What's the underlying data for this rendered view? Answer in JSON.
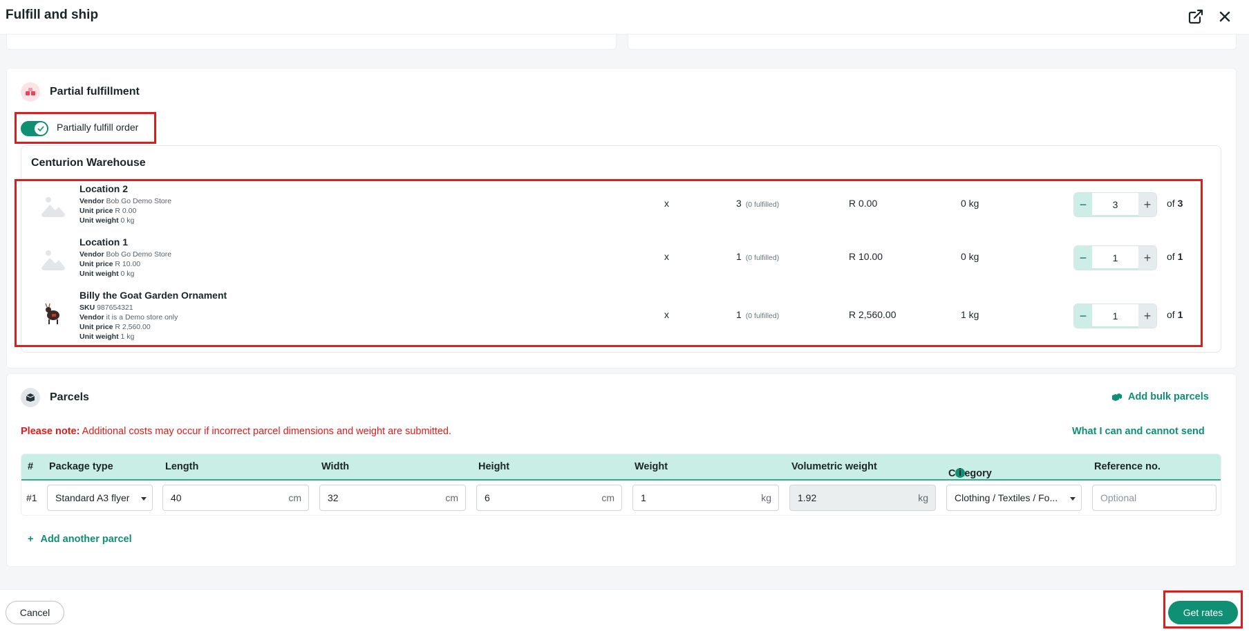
{
  "header": {
    "title": "Fulfill and ship"
  },
  "partial": {
    "section_title": "Partial fulfillment",
    "toggle_label": "Partially fulfill order",
    "toggle_on": true
  },
  "warehouse": {
    "name": "Centurion Warehouse",
    "items": [
      {
        "name": "Location 2",
        "sku_label": "",
        "sku": "",
        "vendor_label": "Vendor",
        "vendor": "Bob Go Demo Store",
        "unit_price_label": "Unit price",
        "unit_price": "R 0.00",
        "unit_weight_label": "Unit weight",
        "unit_weight": "0 kg",
        "x": "x",
        "qty": "3",
        "fulfilled": "(0 fulfilled)",
        "price": "R 0.00",
        "weight": "0 kg",
        "stepper_value": "3",
        "of_label": "of",
        "of_total": "3"
      },
      {
        "name": "Location 1",
        "sku_label": "",
        "sku": "",
        "vendor_label": "Vendor",
        "vendor": "Bob Go Demo Store",
        "unit_price_label": "Unit price",
        "unit_price": "R 10.00",
        "unit_weight_label": "Unit weight",
        "unit_weight": "0 kg",
        "x": "x",
        "qty": "1",
        "fulfilled": "(0 fulfilled)",
        "price": "R 10.00",
        "weight": "0 kg",
        "stepper_value": "1",
        "of_label": "of",
        "of_total": "1"
      },
      {
        "name": "Billy the Goat Garden Ornament",
        "sku_label": "SKU",
        "sku": "987654321",
        "vendor_label": "Vendor",
        "vendor": "it is a Demo store only",
        "unit_price_label": "Unit price",
        "unit_price": "R 2,560.00",
        "unit_weight_label": "Unit weight",
        "unit_weight": "1 kg",
        "x": "x",
        "qty": "1",
        "fulfilled": "(0 fulfilled)",
        "price": "R 2,560.00",
        "weight": "1 kg",
        "stepper_value": "1",
        "of_label": "of",
        "of_total": "1"
      }
    ]
  },
  "parcels": {
    "section_title": "Parcels",
    "add_bulk": "Add bulk parcels",
    "note_label": "Please note:",
    "note_text": " Additional costs may occur if incorrect parcel dimensions and weight are submitted.",
    "what_link": "What I can and cannot send",
    "columns": [
      "#",
      "Package type",
      "Length",
      "Width",
      "Height",
      "Weight",
      "Volumetric weight",
      "Category",
      "Reference no."
    ],
    "row": {
      "num": "#1",
      "package_type": "Standard A3 flyer",
      "length": "40",
      "length_unit": "cm",
      "width": "32",
      "width_unit": "cm",
      "height": "6",
      "height_unit": "cm",
      "weight": "1",
      "weight_unit": "kg",
      "volumetric": "1.92",
      "volumetric_unit": "kg",
      "category": "Clothing / Textiles / Fo...",
      "reference_placeholder": "Optional"
    },
    "add_parcel": "Add another parcel"
  },
  "footer": {
    "cancel": "Cancel",
    "get_rates": "Get rates"
  },
  "colors": {
    "accent": "#0f8f73",
    "highlight": "#e31b1b",
    "table_header": "#c9eee5"
  }
}
